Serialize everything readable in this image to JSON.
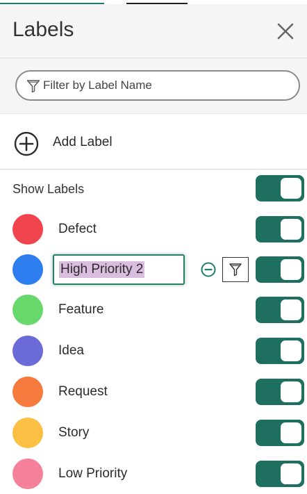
{
  "header": {
    "title": "Labels"
  },
  "search": {
    "placeholder": "Filter by Label Name"
  },
  "add": {
    "label": "Add Label"
  },
  "show": {
    "label": "Show Labels",
    "enabled": true
  },
  "labels": [
    {
      "name": "Defect",
      "color": "#f0454f",
      "visible": true
    },
    {
      "name": "High Priority 2",
      "color": "#2f7ef0",
      "visible": true,
      "editing": true
    },
    {
      "name": "Feature",
      "color": "#68d76c",
      "visible": true
    },
    {
      "name": "Idea",
      "color": "#6b6bd8",
      "visible": true
    },
    {
      "name": "Request",
      "color": "#f47b3d",
      "visible": true
    },
    {
      "name": "Story",
      "color": "#fbbf43",
      "visible": true
    },
    {
      "name": "Low Priority",
      "color": "#f48099",
      "visible": true
    }
  ],
  "colors": {
    "accent": "#1e6f60"
  }
}
